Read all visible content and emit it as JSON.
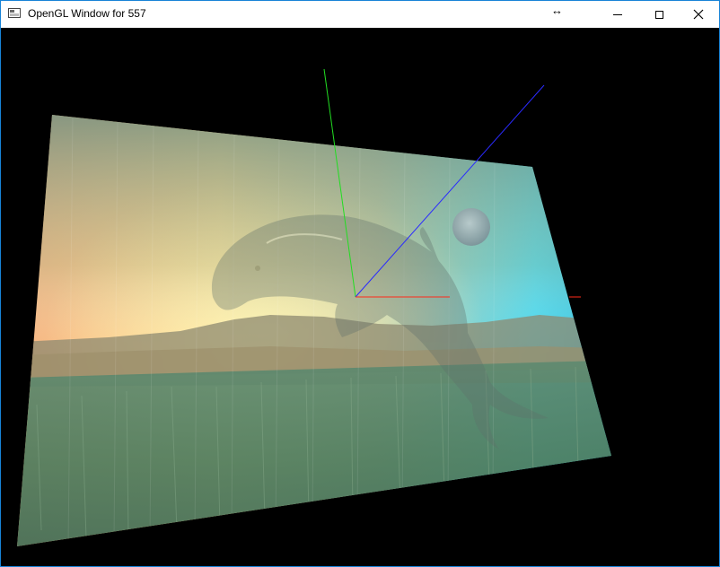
{
  "window": {
    "title": "OpenGL Window for 557",
    "resize_indicator": "↔",
    "controls": {
      "minimize": "minimize",
      "maximize": "maximize",
      "close": "close"
    }
  },
  "viewport": {
    "background_color": "#000000",
    "axes_colors": {
      "x": "#ff2a1a",
      "y": "#22dd22",
      "z": "#2a2aff"
    },
    "textured_quad": {
      "content": [
        "dolphin",
        "moon",
        "sunset sky",
        "mountains",
        "grass field"
      ]
    }
  }
}
